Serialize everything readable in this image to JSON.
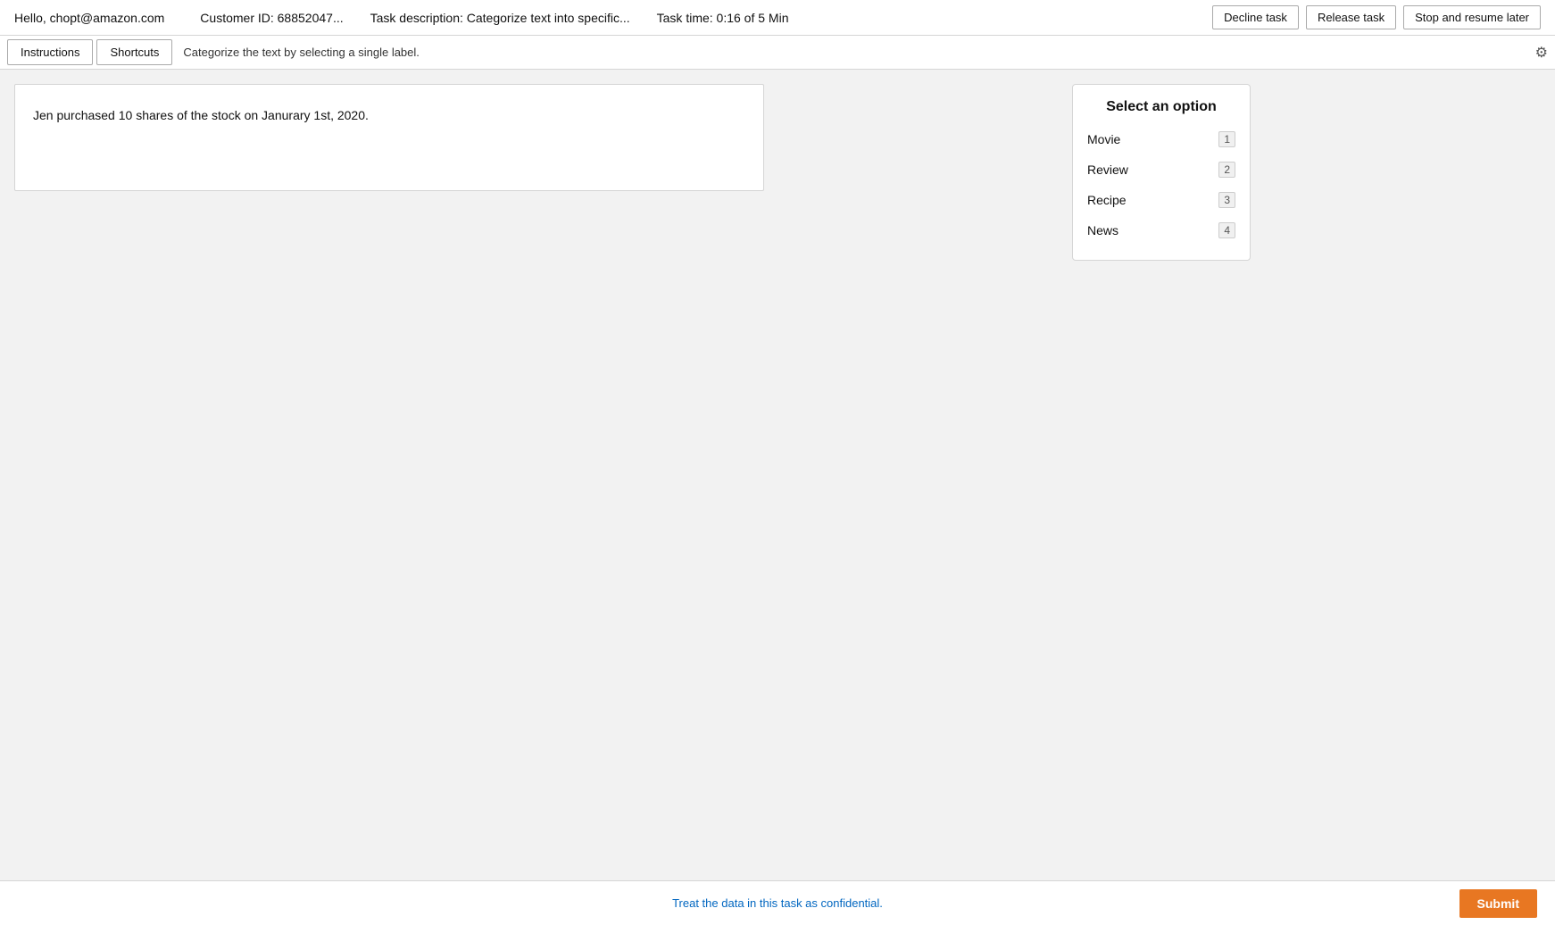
{
  "header": {
    "greeting": "Hello, chopt@amazon.com",
    "customer_id": "Customer ID: 68852047...",
    "task_description": "Task description: Categorize text into specific...",
    "task_time": "Task time: 0:16 of 5 Min",
    "decline_label": "Decline task",
    "release_label": "Release task",
    "stop_resume_label": "Stop and resume later"
  },
  "tabs": {
    "instructions_label": "Instructions",
    "shortcuts_label": "Shortcuts",
    "hint_text": "Categorize the text by selecting a single label."
  },
  "text_card": {
    "content": "Jen purchased 10 shares of the stock on Janurary 1st, 2020."
  },
  "options_panel": {
    "title": "Select an option",
    "options": [
      {
        "label": "Movie",
        "shortcut": "1"
      },
      {
        "label": "Review",
        "shortcut": "2"
      },
      {
        "label": "Recipe",
        "shortcut": "3"
      },
      {
        "label": "News",
        "shortcut": "4"
      }
    ]
  },
  "footer": {
    "confidential_text": "Treat the data in this task as confidential.",
    "submit_label": "Submit"
  },
  "icons": {
    "settings": "⚙"
  }
}
